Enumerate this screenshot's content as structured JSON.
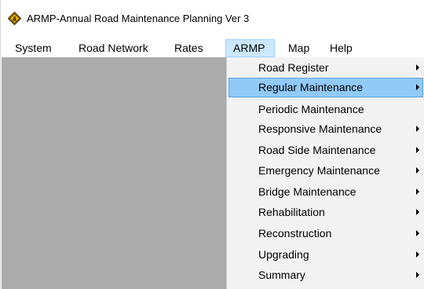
{
  "window": {
    "title": "ARMP-Annual Road Maintenance Planning Ver 3",
    "icon": "road-warning-sign-icon"
  },
  "menubar": {
    "items": [
      {
        "label": "System"
      },
      {
        "label": "Road Network"
      },
      {
        "label": "Rates"
      },
      {
        "label": "ARMP",
        "open": true
      },
      {
        "label": "Map"
      },
      {
        "label": "Help"
      }
    ]
  },
  "armp_menu": {
    "highlighted": "Regular Maintenance",
    "items": [
      {
        "label": "Road Register",
        "submenu": true
      },
      {
        "label": "Regular Maintenance",
        "submenu": true
      },
      {
        "label": "Periodic Maintenance",
        "submenu": false
      },
      {
        "label": "Responsive Maintenance",
        "submenu": true
      },
      {
        "label": "Road Side Maintenance",
        "submenu": true
      },
      {
        "label": "Emergency Maintenance",
        "submenu": true
      },
      {
        "label": "Bridge Maintenance",
        "submenu": true
      },
      {
        "label": "Rehabilitation",
        "submenu": true
      },
      {
        "label": "Reconstruction",
        "submenu": true
      },
      {
        "label": "Upgrading",
        "submenu": true
      },
      {
        "label": "Summary",
        "submenu": true
      }
    ]
  },
  "colors": {
    "workspace": "#ababab",
    "menu_open_background": "#cce8ff",
    "item_highlight": "#91c9f7",
    "dropdown_background": "#f2f2f2"
  }
}
